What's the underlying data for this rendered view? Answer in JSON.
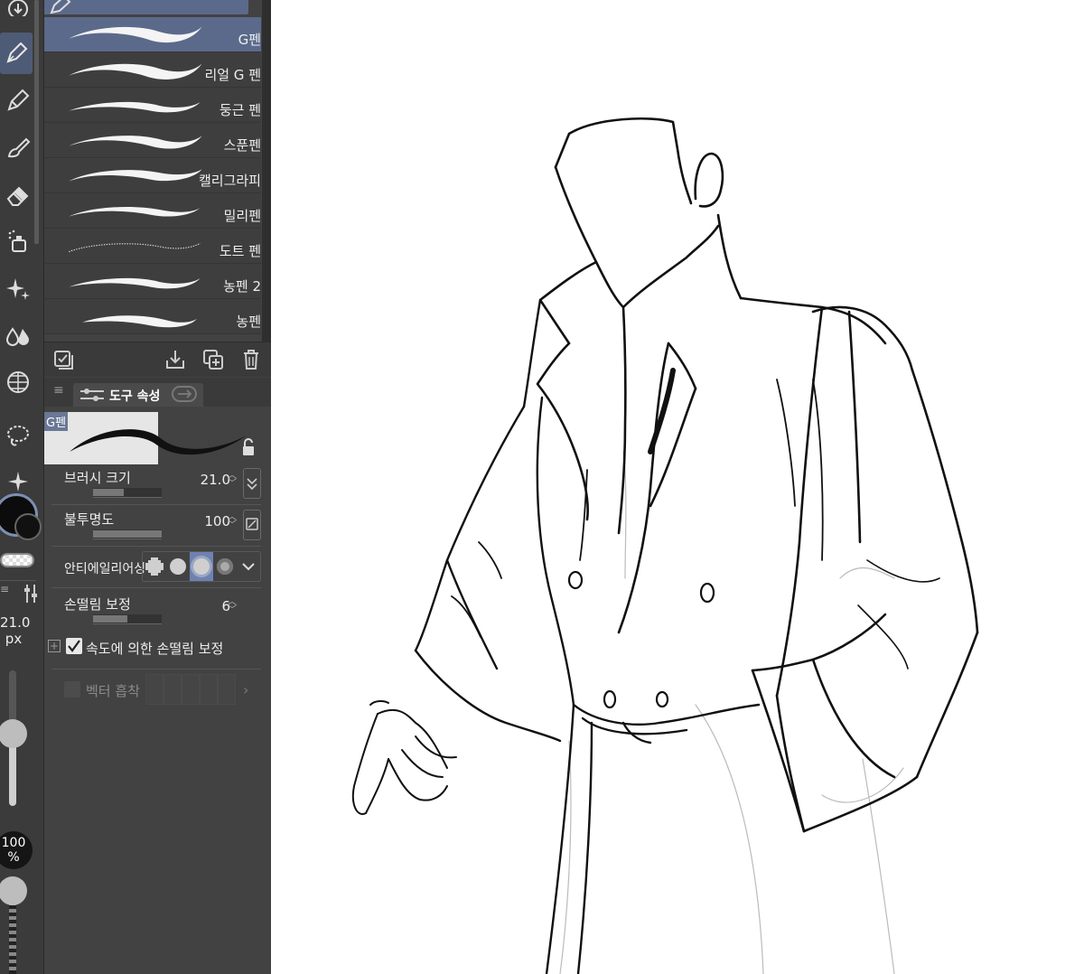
{
  "brush_group_icon": "pen-icon",
  "brushes": [
    {
      "label": "G펜",
      "selected": true
    },
    {
      "label": "리얼 G 펜",
      "selected": false
    },
    {
      "label": "둥근 펜",
      "selected": false
    },
    {
      "label": "스푼펜",
      "selected": false
    },
    {
      "label": "캘리그라피",
      "selected": false
    },
    {
      "label": "밀리펜",
      "selected": false
    },
    {
      "label": "도트 펜",
      "selected": false
    },
    {
      "label": "농펜 2",
      "selected": false
    },
    {
      "label": "농펜",
      "selected": false
    }
  ],
  "tool_property": {
    "tab_title": "도구 속성",
    "preview_name": "G펜",
    "brush_size": {
      "label": "브러시 크기",
      "value": "21.0",
      "level": 0.45
    },
    "opacity": {
      "label": "불투명도",
      "value": "100",
      "level": 1.0
    },
    "antialiasing": {
      "label": "안티에일리어싱",
      "selected_index": 2
    },
    "stabilization": {
      "label": "손떨림 보정",
      "value": "6",
      "level": 0.5
    },
    "speed_stabilization": {
      "label": "속도에 의한 손떨림 보정",
      "checked": true
    },
    "vector_snap": {
      "label": "벡터 흡착",
      "enabled": false
    }
  },
  "left_strip": {
    "size_value": "21.0",
    "size_unit": "px",
    "opacity_value": "100",
    "opacity_unit": "%",
    "main_color": "#0c0c0c",
    "active_accent": "#7c8fb3"
  },
  "colors": {
    "panel_bg": "#424242",
    "selected_row": "#5b6a8b",
    "canvas": "#ffffff"
  }
}
